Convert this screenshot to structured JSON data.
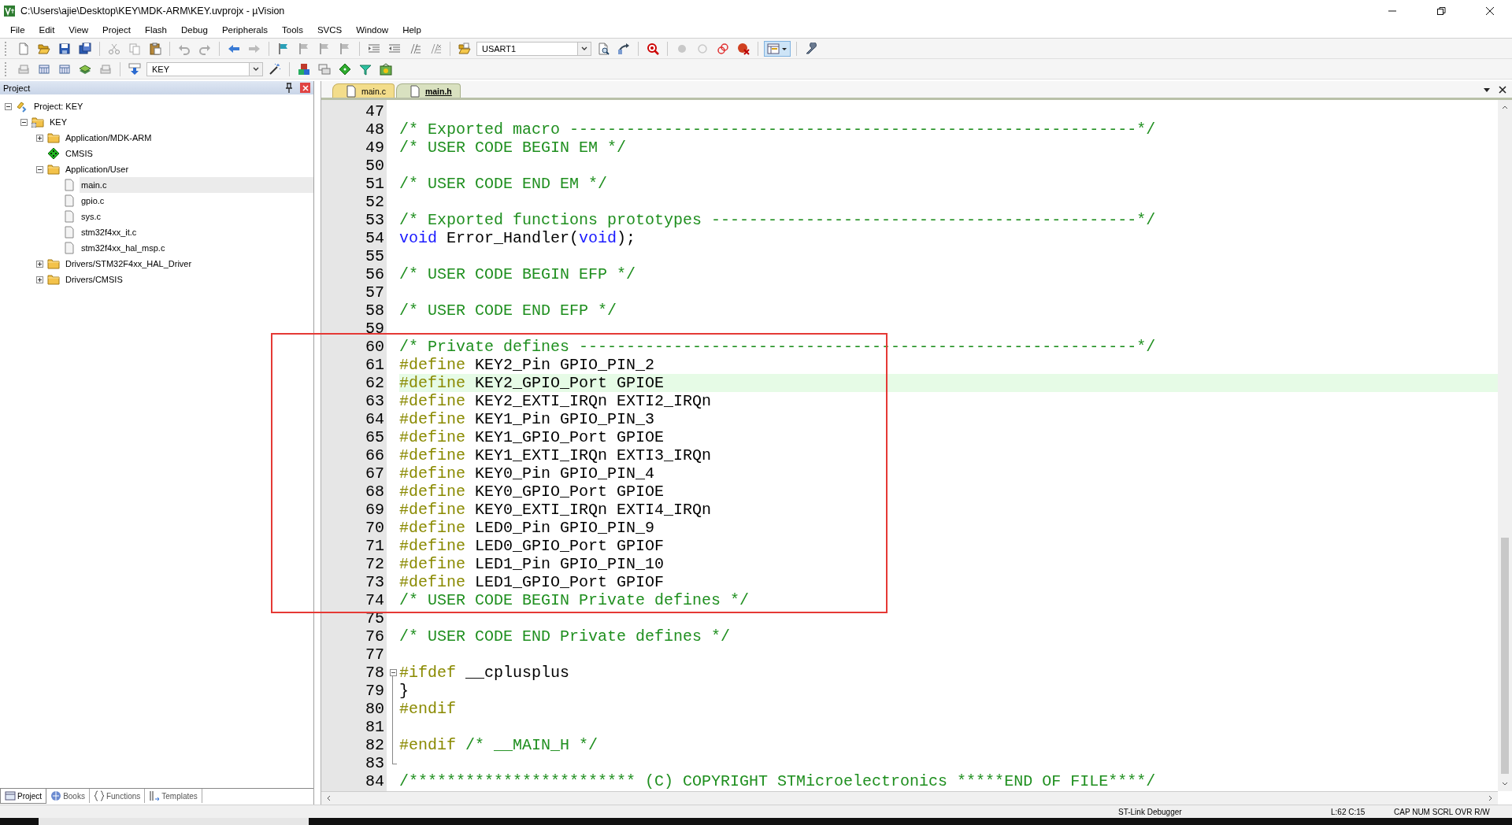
{
  "window": {
    "title": "C:\\Users\\ajie\\Desktop\\KEY\\MDK-ARM\\KEY.uvprojx - µVision"
  },
  "menu": [
    "File",
    "Edit",
    "View",
    "Project",
    "Flash",
    "Debug",
    "Peripherals",
    "Tools",
    "SVCS",
    "Window",
    "Help"
  ],
  "toolbar": {
    "find_dropdown": "USART1",
    "target_dropdown": "KEY"
  },
  "project_panel": {
    "title": "Project",
    "tree": [
      {
        "label": "Project: KEY",
        "kind": "project",
        "expanded": true,
        "selected": false,
        "children": [
          {
            "label": "KEY",
            "kind": "target",
            "expanded": true,
            "selected": false,
            "children": [
              {
                "label": "Application/MDK-ARM",
                "kind": "folder",
                "expanded": false,
                "selected": false
              },
              {
                "label": "CMSIS",
                "kind": "package",
                "selected": false
              },
              {
                "label": "Application/User",
                "kind": "folder",
                "expanded": true,
                "selected": false,
                "children": [
                  {
                    "label": "main.c",
                    "kind": "file",
                    "selected": true
                  },
                  {
                    "label": "gpio.c",
                    "kind": "file",
                    "selected": false
                  },
                  {
                    "label": "sys.c",
                    "kind": "file",
                    "selected": false
                  },
                  {
                    "label": "stm32f4xx_it.c",
                    "kind": "file",
                    "selected": false
                  },
                  {
                    "label": "stm32f4xx_hal_msp.c",
                    "kind": "file",
                    "selected": false
                  }
                ]
              },
              {
                "label": "Drivers/STM32F4xx_HAL_Driver",
                "kind": "folder",
                "expanded": false,
                "selected": false
              },
              {
                "label": "Drivers/CMSIS",
                "kind": "folder",
                "expanded": false,
                "selected": false
              }
            ]
          }
        ]
      }
    ],
    "bottom_tabs": [
      {
        "label": "Project",
        "kind": "project",
        "selected": true
      },
      {
        "label": "Books",
        "kind": "books",
        "selected": false
      },
      {
        "label": "Functions",
        "kind": "functions",
        "selected": false
      },
      {
        "label": "Templates",
        "kind": "templates",
        "selected": false
      }
    ]
  },
  "editor": {
    "tabs": [
      {
        "label": "main.c",
        "selected": false
      },
      {
        "label": "main.h",
        "selected": true
      }
    ],
    "lines": [
      {
        "number": "47",
        "current": false,
        "fold_start": false,
        "fold_end": false
      },
      {
        "number": "48",
        "current": false,
        "fold_start": false,
        "fold_end": false,
        "segments": [
          {
            "kind": "comment",
            "text": "/* Exported macro ------------------------------------------------------------*/"
          }
        ]
      },
      {
        "number": "49",
        "current": false,
        "fold_start": false,
        "fold_end": false,
        "segments": [
          {
            "kind": "comment",
            "text": "/* USER CODE BEGIN EM */"
          }
        ]
      },
      {
        "number": "50",
        "current": false,
        "fold_start": false,
        "fold_end": false
      },
      {
        "number": "51",
        "current": false,
        "fold_start": false,
        "fold_end": false,
        "segments": [
          {
            "kind": "comment",
            "text": "/* USER CODE END EM */"
          }
        ]
      },
      {
        "number": "52",
        "current": false,
        "fold_start": false,
        "fold_end": false
      },
      {
        "number": "53",
        "current": false,
        "fold_start": false,
        "fold_end": false,
        "segments": [
          {
            "kind": "comment",
            "text": "/* Exported functions prototypes ---------------------------------------------*/"
          }
        ]
      },
      {
        "number": "54",
        "current": false,
        "fold_start": false,
        "fold_end": false,
        "segments": [
          {
            "kind": "keyword",
            "text": "void"
          },
          {
            "kind": "plain",
            "text": " Error_Handler("
          },
          {
            "kind": "keyword",
            "text": "void"
          },
          {
            "kind": "plain",
            "text": ");"
          }
        ]
      },
      {
        "number": "55",
        "current": false,
        "fold_start": false,
        "fold_end": false
      },
      {
        "number": "56",
        "current": false,
        "fold_start": false,
        "fold_end": false,
        "segments": [
          {
            "kind": "comment",
            "text": "/* USER CODE BEGIN EFP */"
          }
        ]
      },
      {
        "number": "57",
        "current": false,
        "fold_start": false,
        "fold_end": false
      },
      {
        "number": "58",
        "current": false,
        "fold_start": false,
        "fold_end": false,
        "segments": [
          {
            "kind": "comment",
            "text": "/* USER CODE END EFP */"
          }
        ]
      },
      {
        "number": "59",
        "current": false,
        "fold_start": false,
        "fold_end": false
      },
      {
        "number": "60",
        "current": false,
        "fold_start": false,
        "fold_end": false,
        "segments": [
          {
            "kind": "comment",
            "text": "/* Private defines -----------------------------------------------------------*/"
          }
        ]
      },
      {
        "number": "61",
        "current": false,
        "fold_start": false,
        "fold_end": false,
        "segments": [
          {
            "kind": "preprocessor",
            "text": "#define"
          },
          {
            "kind": "plain",
            "text": " KEY2_Pin GPIO_PIN_2"
          }
        ]
      },
      {
        "number": "62",
        "current": true,
        "fold_start": false,
        "fold_end": false,
        "segments": [
          {
            "kind": "preprocessor",
            "text": "#define"
          },
          {
            "kind": "plain",
            "text": " KEY2_GPIO_Port GPIOE"
          }
        ]
      },
      {
        "number": "63",
        "current": false,
        "fold_start": false,
        "fold_end": false,
        "segments": [
          {
            "kind": "preprocessor",
            "text": "#define"
          },
          {
            "kind": "plain",
            "text": " KEY2_EXTI_IRQn EXTI2_IRQn"
          }
        ]
      },
      {
        "number": "64",
        "current": false,
        "fold_start": false,
        "fold_end": false,
        "segments": [
          {
            "kind": "preprocessor",
            "text": "#define"
          },
          {
            "kind": "plain",
            "text": " KEY1_Pin GPIO_PIN_3"
          }
        ]
      },
      {
        "number": "65",
        "current": false,
        "fold_start": false,
        "fold_end": false,
        "segments": [
          {
            "kind": "preprocessor",
            "text": "#define"
          },
          {
            "kind": "plain",
            "text": " KEY1_GPIO_Port GPIOE"
          }
        ]
      },
      {
        "number": "66",
        "current": false,
        "fold_start": false,
        "fold_end": false,
        "segments": [
          {
            "kind": "preprocessor",
            "text": "#define"
          },
          {
            "kind": "plain",
            "text": " KEY1_EXTI_IRQn EXTI3_IRQn"
          }
        ]
      },
      {
        "number": "67",
        "current": false,
        "fold_start": false,
        "fold_end": false,
        "segments": [
          {
            "kind": "preprocessor",
            "text": "#define"
          },
          {
            "kind": "plain",
            "text": " KEY0_Pin GPIO_PIN_4"
          }
        ]
      },
      {
        "number": "68",
        "current": false,
        "fold_start": false,
        "fold_end": false,
        "segments": [
          {
            "kind": "preprocessor",
            "text": "#define"
          },
          {
            "kind": "plain",
            "text": " KEY0_GPIO_Port GPIOE"
          }
        ]
      },
      {
        "number": "69",
        "current": false,
        "fold_start": false,
        "fold_end": false,
        "segments": [
          {
            "kind": "preprocessor",
            "text": "#define"
          },
          {
            "kind": "plain",
            "text": " KEY0_EXTI_IRQn EXTI4_IRQn"
          }
        ]
      },
      {
        "number": "70",
        "current": false,
        "fold_start": false,
        "fold_end": false,
        "segments": [
          {
            "kind": "preprocessor",
            "text": "#define"
          },
          {
            "kind": "plain",
            "text": " LED0_Pin GPIO_PIN_9"
          }
        ]
      },
      {
        "number": "71",
        "current": false,
        "fold_start": false,
        "fold_end": false,
        "segments": [
          {
            "kind": "preprocessor",
            "text": "#define"
          },
          {
            "kind": "plain",
            "text": " LED0_GPIO_Port GPIOF"
          }
        ]
      },
      {
        "number": "72",
        "current": false,
        "fold_start": false,
        "fold_end": false,
        "segments": [
          {
            "kind": "preprocessor",
            "text": "#define"
          },
          {
            "kind": "plain",
            "text": " LED1_Pin GPIO_PIN_10"
          }
        ]
      },
      {
        "number": "73",
        "current": false,
        "fold_start": false,
        "fold_end": false,
        "segments": [
          {
            "kind": "preprocessor",
            "text": "#define"
          },
          {
            "kind": "plain",
            "text": " LED1_GPIO_Port GPIOF"
          }
        ]
      },
      {
        "number": "74",
        "current": false,
        "fold_start": false,
        "fold_end": false,
        "segments": [
          {
            "kind": "comment",
            "text": "/* USER CODE BEGIN Private defines */"
          }
        ]
      },
      {
        "number": "75",
        "current": false,
        "fold_start": false,
        "fold_end": false
      },
      {
        "number": "76",
        "current": false,
        "fold_start": false,
        "fold_end": false,
        "segments": [
          {
            "kind": "comment",
            "text": "/* USER CODE END Private defines */"
          }
        ]
      },
      {
        "number": "77",
        "current": false,
        "fold_start": false,
        "fold_end": false
      },
      {
        "number": "78",
        "current": false,
        "fold_start": true,
        "fold_end": false,
        "segments": [
          {
            "kind": "preprocessor",
            "text": "#ifdef"
          },
          {
            "kind": "plain",
            "text": " __cplusplus"
          }
        ]
      },
      {
        "number": "79",
        "current": false,
        "fold_start": false,
        "fold_end": false,
        "segments": [
          {
            "kind": "plain",
            "text": "}"
          }
        ]
      },
      {
        "number": "80",
        "current": false,
        "fold_start": false,
        "fold_end": false,
        "segments": [
          {
            "kind": "preprocessor",
            "text": "#endif"
          }
        ]
      },
      {
        "number": "81",
        "current": false,
        "fold_start": false,
        "fold_end": false
      },
      {
        "number": "82",
        "current": false,
        "fold_start": false,
        "fold_end": false,
        "segments": [
          {
            "kind": "preprocessor",
            "text": "#endif"
          },
          {
            "kind": "comment",
            "text": " /* __MAIN_H */"
          }
        ]
      },
      {
        "number": "83",
        "current": false,
        "fold_start": false,
        "fold_end": true
      },
      {
        "number": "84",
        "current": false,
        "fold_start": false,
        "fold_end": false,
        "segments": [
          {
            "kind": "comment",
            "text": "/************************ (C) COPYRIGHT STMicroelectronics *****END OF FILE****/"
          }
        ]
      }
    ]
  },
  "status_bar": {
    "debugger": "ST-Link Debugger",
    "position": "L:62 C:15",
    "indicators": "CAP NUM SCRL OVR R/W"
  }
}
